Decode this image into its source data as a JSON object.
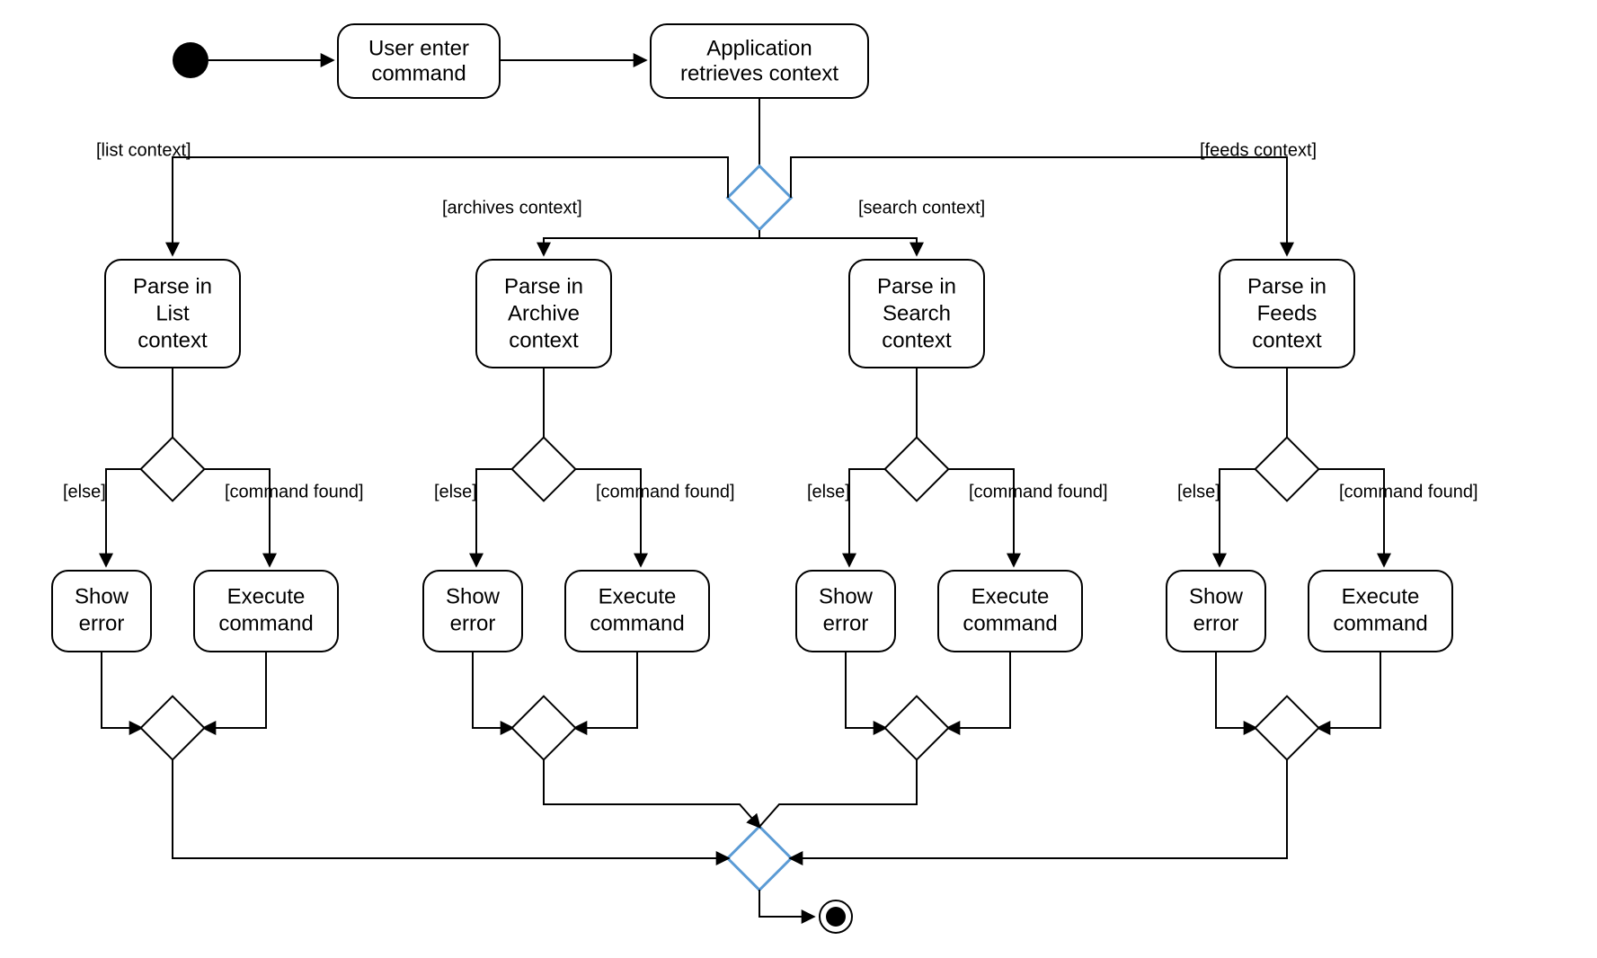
{
  "diagram": {
    "type": "UML Activity Diagram",
    "start": "initial",
    "end": "final",
    "activities": {
      "userEnter": {
        "line1": "User enter",
        "line2": "command"
      },
      "appRetrieves": {
        "line1": "Application",
        "line2": "retrieves context"
      }
    },
    "guards": {
      "listContext": "[list context]",
      "archivesContext": "[archives context]",
      "searchContext": "[search context]",
      "feedsContext": "[feeds context]",
      "else": "[else]",
      "commandFound": "[command found]"
    },
    "branches": [
      {
        "id": "list",
        "parse": {
          "l1": "Parse in",
          "l2": "List",
          "l3": "context"
        },
        "error": {
          "l1": "Show",
          "l2": "error"
        },
        "exec": {
          "l1": "Execute",
          "l2": "command"
        }
      },
      {
        "id": "archive",
        "parse": {
          "l1": "Parse in",
          "l2": "Archive",
          "l3": "context"
        },
        "error": {
          "l1": "Show",
          "l2": "error"
        },
        "exec": {
          "l1": "Execute",
          "l2": "command"
        }
      },
      {
        "id": "search",
        "parse": {
          "l1": "Parse in",
          "l2": "Search",
          "l3": "context"
        },
        "error": {
          "l1": "Show",
          "l2": "error"
        },
        "exec": {
          "l1": "Execute",
          "l2": "command"
        }
      },
      {
        "id": "feeds",
        "parse": {
          "l1": "Parse in",
          "l2": "Feeds",
          "l3": "context"
        },
        "error": {
          "l1": "Show",
          "l2": "error"
        },
        "exec": {
          "l1": "Execute",
          "l2": "command"
        }
      }
    ]
  }
}
